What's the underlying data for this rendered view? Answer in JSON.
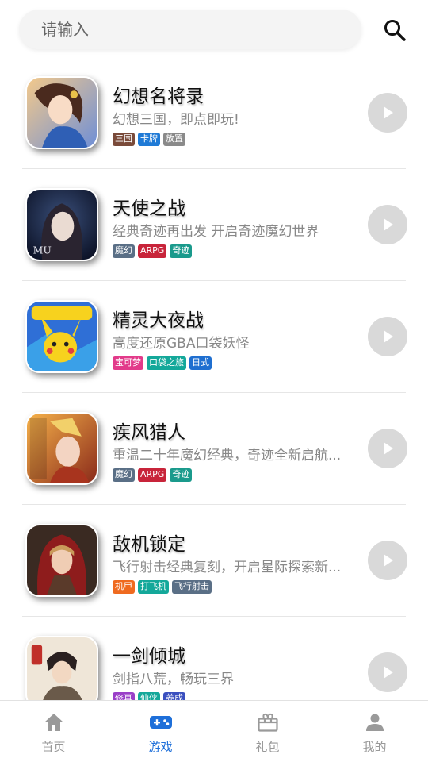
{
  "search": {
    "placeholder": "请输入"
  },
  "games": [
    {
      "title": "幻想名将录",
      "desc": "幻想三国，即点即玩!",
      "icon": "fantasy-generals-icon",
      "tags": [
        {
          "label": "三国",
          "color": "#7a4b3a"
        },
        {
          "label": "卡牌",
          "color": "#1f7ad6"
        },
        {
          "label": "放置",
          "color": "#8a8a8a"
        }
      ]
    },
    {
      "title": "天使之战",
      "desc": "经典奇迹再出发 开启奇迹魔幻世界",
      "icon": "angel-war-icon",
      "tags": [
        {
          "label": "魔幻",
          "color": "#5a6f86"
        },
        {
          "label": "ARPG",
          "color": "#c8243a"
        },
        {
          "label": "奇迹",
          "color": "#1a9a8c"
        }
      ]
    },
    {
      "title": "精灵大夜战",
      "desc": "高度还原GBA口袋妖怪",
      "icon": "pikachu-icon",
      "tags": [
        {
          "label": "宝可梦",
          "color": "#e23a8a"
        },
        {
          "label": "口袋之旅",
          "color": "#14a89a"
        },
        {
          "label": "日式",
          "color": "#1f6fd0"
        }
      ]
    },
    {
      "title": "疾风猎人",
      "desc": "重温二十年魔幻经典，奇迹全新启航...",
      "icon": "wind-hunter-icon",
      "tags": [
        {
          "label": "魔幻",
          "color": "#5a6f86"
        },
        {
          "label": "ARPG",
          "color": "#c8243a"
        },
        {
          "label": "奇迹",
          "color": "#1a9a8c"
        }
      ]
    },
    {
      "title": "敌机锁定",
      "desc": "飞行射击经典复刻，开启星际探索新...",
      "icon": "red-hood-icon",
      "tags": [
        {
          "label": "机甲",
          "color": "#ef6a1f"
        },
        {
          "label": "打飞机",
          "color": "#14a89a"
        },
        {
          "label": "飞行射击",
          "color": "#5a6f86"
        }
      ]
    },
    {
      "title": "一剑倾城",
      "desc": "剑指八荒，畅玩三界",
      "icon": "swordsman-icon",
      "tags": [
        {
          "label": "修真",
          "color": "#9a3fc8"
        },
        {
          "label": "仙侠",
          "color": "#14a89a"
        },
        {
          "label": "养成",
          "color": "#3a4fbf"
        }
      ]
    }
  ],
  "nav": [
    {
      "label": "首页",
      "icon": "home-icon",
      "active": false
    },
    {
      "label": "游戏",
      "icon": "gamepad-icon",
      "active": true
    },
    {
      "label": "礼包",
      "icon": "gift-icon",
      "active": false
    },
    {
      "label": "我的",
      "icon": "user-icon",
      "active": false
    }
  ],
  "colors": {
    "accent": "#1e6fd9",
    "inactive": "#999999",
    "play_button": "#d9d9d9"
  }
}
